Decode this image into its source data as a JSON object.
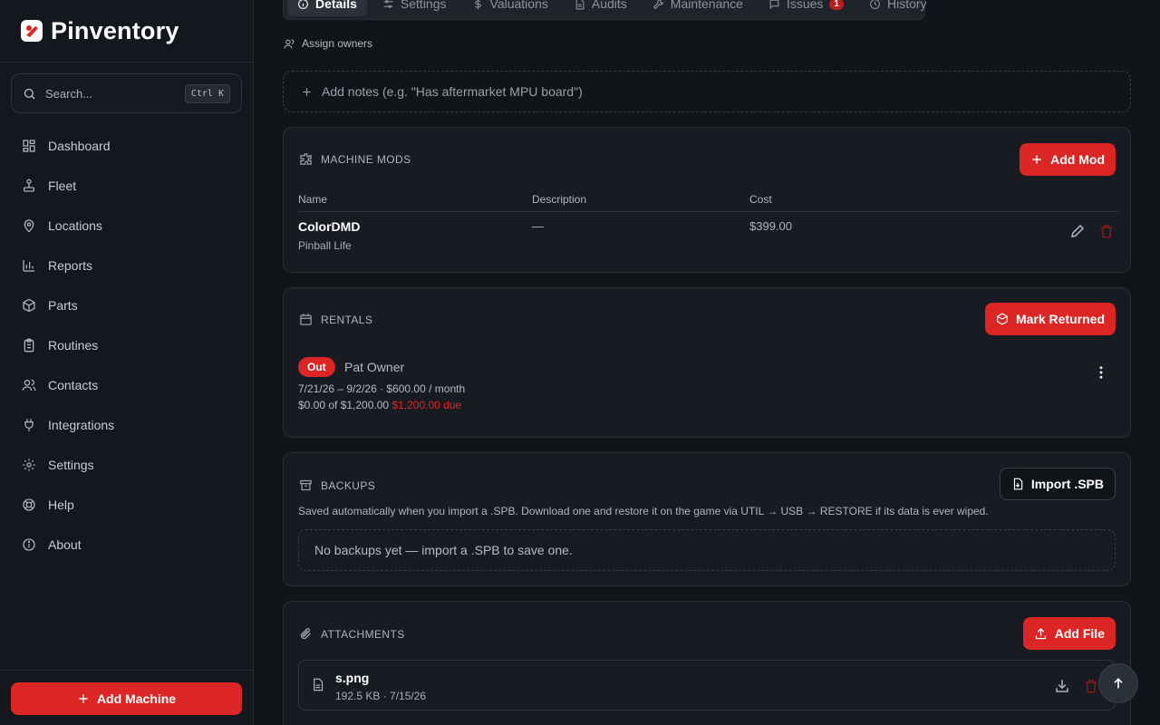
{
  "brand": {
    "name": "Pinventory"
  },
  "search": {
    "placeholder": "Search...",
    "shortcut": "Ctrl K"
  },
  "nav": {
    "items": [
      {
        "label": "Dashboard",
        "icon": "dashboard-icon"
      },
      {
        "label": "Fleet",
        "icon": "joystick-icon"
      },
      {
        "label": "Locations",
        "icon": "map-pin-icon"
      },
      {
        "label": "Reports",
        "icon": "bar-chart-icon"
      },
      {
        "label": "Parts",
        "icon": "package-icon"
      },
      {
        "label": "Routines",
        "icon": "clipboard-icon"
      },
      {
        "label": "Contacts",
        "icon": "users-icon"
      },
      {
        "label": "Integrations",
        "icon": "plug-icon"
      },
      {
        "label": "Settings",
        "icon": "gear-icon"
      },
      {
        "label": "Help",
        "icon": "life-buoy-icon"
      },
      {
        "label": "About",
        "icon": "info-icon"
      }
    ]
  },
  "sidebar_footer": {
    "add_machine_label": "Add Machine"
  },
  "tabs": [
    {
      "label": "Details",
      "active": true
    },
    {
      "label": "Settings"
    },
    {
      "label": "Valuations"
    },
    {
      "label": "Audits"
    },
    {
      "label": "Maintenance"
    },
    {
      "label": "Issues",
      "badge": "1"
    },
    {
      "label": "History"
    }
  ],
  "assign_owners": "Assign owners",
  "notes_placeholder": "Add notes (e.g. \"Has aftermarket MPU board\")",
  "mods": {
    "title": "MACHINE MODS",
    "add_label": "Add Mod",
    "columns": [
      "Name",
      "Description",
      "Cost"
    ],
    "rows": [
      {
        "name": "ColorDMD",
        "vendor": "Pinball Life",
        "description": "—",
        "cost": "$399.00"
      }
    ]
  },
  "rentals": {
    "title": "RENTALS",
    "action_label": "Mark Returned",
    "status": "Out",
    "renter": "Pat Owner",
    "period": "7/21/26 – 9/2/26 · $600.00 / month",
    "paid": "$0.00 of $1,200.00",
    "due": "$1,200.00 due"
  },
  "backups": {
    "title": "BACKUPS",
    "import_label": "Import .SPB",
    "description": "Saved automatically when you import a .SPB. Download one and restore it on the game via UTIL → USB → RESTORE if its data is ever wiped.",
    "empty": "No backups yet — import a .SPB to save one."
  },
  "attachments": {
    "title": "ATTACHMENTS",
    "add_label": "Add File",
    "files": [
      {
        "name": "s.png",
        "meta": "192.5 KB · 7/15/26"
      }
    ]
  },
  "colors": {
    "accent": "#dc2626",
    "background": "#111419",
    "surface": "#181c22"
  }
}
